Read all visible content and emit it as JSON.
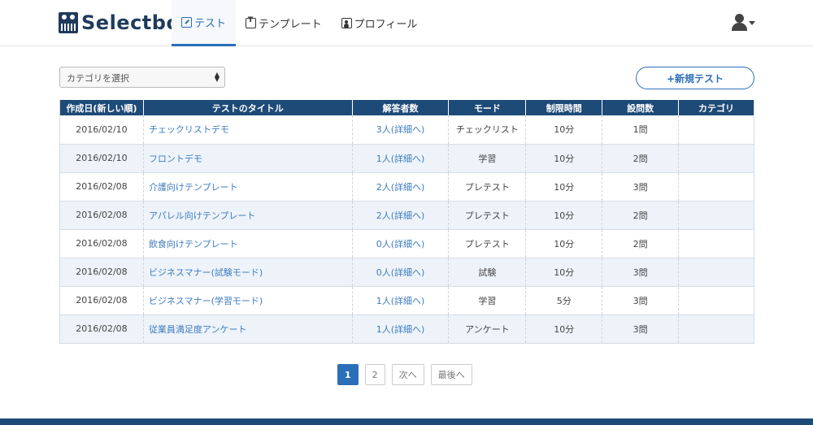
{
  "brand": {
    "name": "Selectbot"
  },
  "nav": {
    "items": [
      {
        "label": "テスト",
        "active": true
      },
      {
        "label": "テンプレート",
        "active": false
      },
      {
        "label": "プロフィール",
        "active": false
      }
    ]
  },
  "toolbar": {
    "category_select_value": "カテゴリを選択",
    "new_test_label": "+新規テスト"
  },
  "table": {
    "columns": [
      "作成日(新しい順)",
      "テストのタイトル",
      "解答者数",
      "モード",
      "制限時間",
      "設問数",
      "カテゴリ"
    ],
    "rows": [
      {
        "date": "2016/02/10",
        "title": "チェックリストデモ",
        "respondents": "3人(詳細へ)",
        "mode": "チェックリスト",
        "time": "10分",
        "questions": "1問",
        "category": ""
      },
      {
        "date": "2016/02/10",
        "title": "フロントデモ",
        "respondents": "1人(詳細へ)",
        "mode": "学習",
        "time": "10分",
        "questions": "2問",
        "category": ""
      },
      {
        "date": "2016/02/08",
        "title": "介護向けテンプレート",
        "respondents": "2人(詳細へ)",
        "mode": "プレテスト",
        "time": "10分",
        "questions": "3問",
        "category": ""
      },
      {
        "date": "2016/02/08",
        "title": "アパレル向けテンプレート",
        "respondents": "2人(詳細へ)",
        "mode": "プレテスト",
        "time": "10分",
        "questions": "2問",
        "category": ""
      },
      {
        "date": "2016/02/08",
        "title": "飲食向けテンプレート",
        "respondents": "0人(詳細へ)",
        "mode": "プレテスト",
        "time": "10分",
        "questions": "2問",
        "category": ""
      },
      {
        "date": "2016/02/08",
        "title": "ビジネスマナー(試験モード)",
        "respondents": "0人(詳細へ)",
        "mode": "試験",
        "time": "10分",
        "questions": "3問",
        "category": ""
      },
      {
        "date": "2016/02/08",
        "title": "ビジネスマナー(学習モード)",
        "respondents": "1人(詳細へ)",
        "mode": "学習",
        "time": "5分",
        "questions": "3問",
        "category": ""
      },
      {
        "date": "2016/02/08",
        "title": "従業員満足度アンケート",
        "respondents": "1人(詳細へ)",
        "mode": "アンケート",
        "time": "10分",
        "questions": "3問",
        "category": ""
      }
    ]
  },
  "pagination": {
    "pages": [
      "1",
      "2"
    ],
    "current": "1",
    "next_label": "次へ",
    "last_label": "最後へ"
  },
  "colors": {
    "accent": "#2a6fb8",
    "table_header": "#1e4a78",
    "link": "#3d7cc0"
  }
}
